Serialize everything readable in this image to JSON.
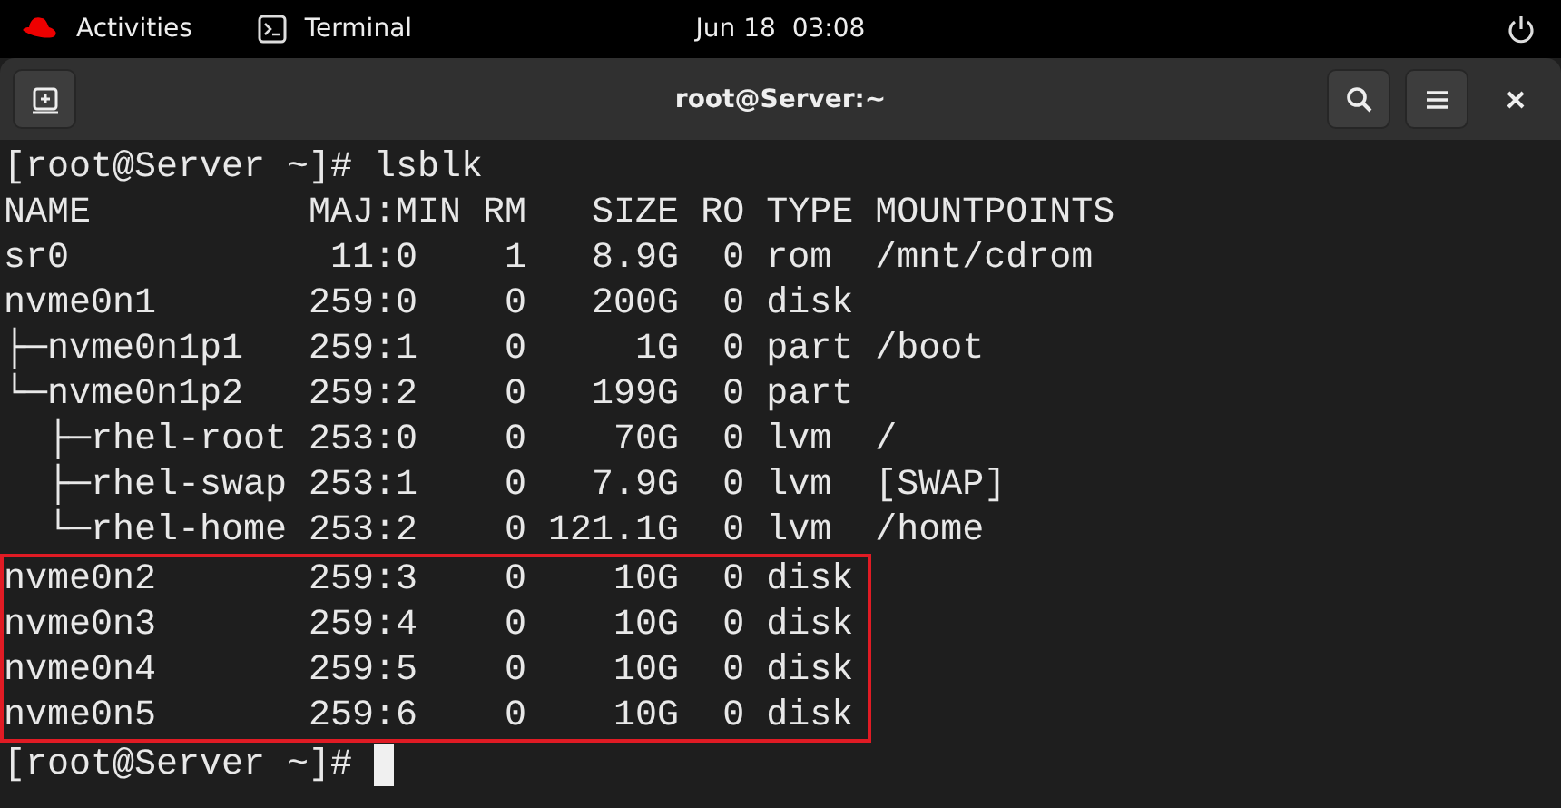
{
  "top_bar": {
    "activities": "Activities",
    "app": "Terminal",
    "clock": "Jun 18  03:08"
  },
  "window": {
    "title": "root@Server:~"
  },
  "terminal": {
    "lines": [
      "[root@Server ~]# lsblk",
      "NAME          MAJ:MIN RM   SIZE RO TYPE MOUNTPOINTS",
      "sr0            11:0    1   8.9G  0 rom  /mnt/cdrom",
      "nvme0n1       259:0    0   200G  0 disk",
      "├─nvme0n1p1   259:1    0     1G  0 part /boot",
      "└─nvme0n1p2   259:2    0   199G  0 part",
      "  ├─rhel-root 253:0    0    70G  0 lvm  /",
      "  ├─rhel-swap 253:1    0   7.9G  0 lvm  [SWAP]",
      "  └─rhel-home 253:2    0 121.1G  0 lvm  /home"
    ],
    "highlighted_lines": [
      "nvme0n2       259:3    0    10G  0 disk",
      "nvme0n3       259:4    0    10G  0 disk",
      "nvme0n4       259:5    0    10G  0 disk",
      "nvme0n5       259:6    0    10G  0 disk"
    ],
    "prompt": "[root@Server ~]# "
  }
}
